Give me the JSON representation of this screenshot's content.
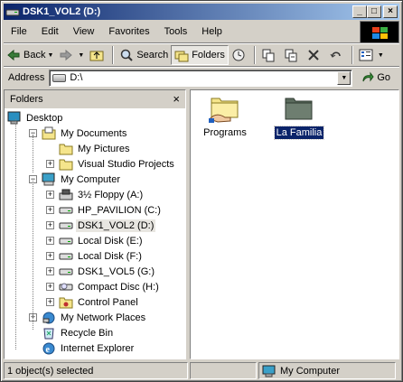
{
  "window": {
    "title": "DSK1_VOL2 (D:)",
    "controls": {
      "minimize": "_",
      "maximize": "□",
      "close": "×"
    }
  },
  "menu": [
    "File",
    "Edit",
    "View",
    "Favorites",
    "Tools",
    "Help"
  ],
  "toolbar": {
    "back": "Back",
    "search": "Search",
    "folders": "Folders"
  },
  "address": {
    "label": "Address",
    "value": "D:\\",
    "go": "Go"
  },
  "folders_pane": {
    "title": "Folders",
    "close": "×",
    "tree": [
      {
        "label": "Desktop",
        "icon": "desktop-icon",
        "level": 0,
        "expander": ""
      },
      {
        "label": "My Documents",
        "icon": "my-documents-icon",
        "level": 1,
        "expander": "−"
      },
      {
        "label": "My Pictures",
        "icon": "folder-icon",
        "level": 2,
        "expander": ""
      },
      {
        "label": "Visual Studio Projects",
        "icon": "folder-icon",
        "level": 2,
        "expander": "+"
      },
      {
        "label": "My Computer",
        "icon": "my-computer-icon",
        "level": 1,
        "expander": "−"
      },
      {
        "label": "3½ Floppy (A:)",
        "icon": "floppy-icon",
        "level": 2,
        "expander": "+"
      },
      {
        "label": "HP_PAVILION (C:)",
        "icon": "drive-icon",
        "level": 2,
        "expander": "+"
      },
      {
        "label": "DSK1_VOL2 (D:)",
        "icon": "drive-icon",
        "level": 2,
        "expander": "+",
        "selected": true
      },
      {
        "label": "Local Disk (E:)",
        "icon": "drive-icon",
        "level": 2,
        "expander": "+"
      },
      {
        "label": "Local Disk (F:)",
        "icon": "drive-icon",
        "level": 2,
        "expander": "+"
      },
      {
        "label": "DSK1_VOL5 (G:)",
        "icon": "drive-icon",
        "level": 2,
        "expander": "+"
      },
      {
        "label": "Compact Disc (H:)",
        "icon": "cd-icon",
        "level": 2,
        "expander": "+"
      },
      {
        "label": "Control Panel",
        "icon": "control-panel-icon",
        "level": 2,
        "expander": "+"
      },
      {
        "label": "My Network Places",
        "icon": "network-icon",
        "level": 1,
        "expander": "+"
      },
      {
        "label": "Recycle Bin",
        "icon": "recycle-bin-icon",
        "level": 1,
        "expander": ""
      },
      {
        "label": "Internet Explorer",
        "icon": "internet-explorer-icon",
        "level": 1,
        "expander": ""
      }
    ]
  },
  "content": {
    "items": [
      {
        "label": "Programs",
        "icon": "shared-folder-icon",
        "selected": false
      },
      {
        "label": "La Familia",
        "icon": "folder-icon",
        "selected": true
      }
    ]
  },
  "status": {
    "selection": "1 object(s) selected",
    "zone": "My Computer"
  }
}
